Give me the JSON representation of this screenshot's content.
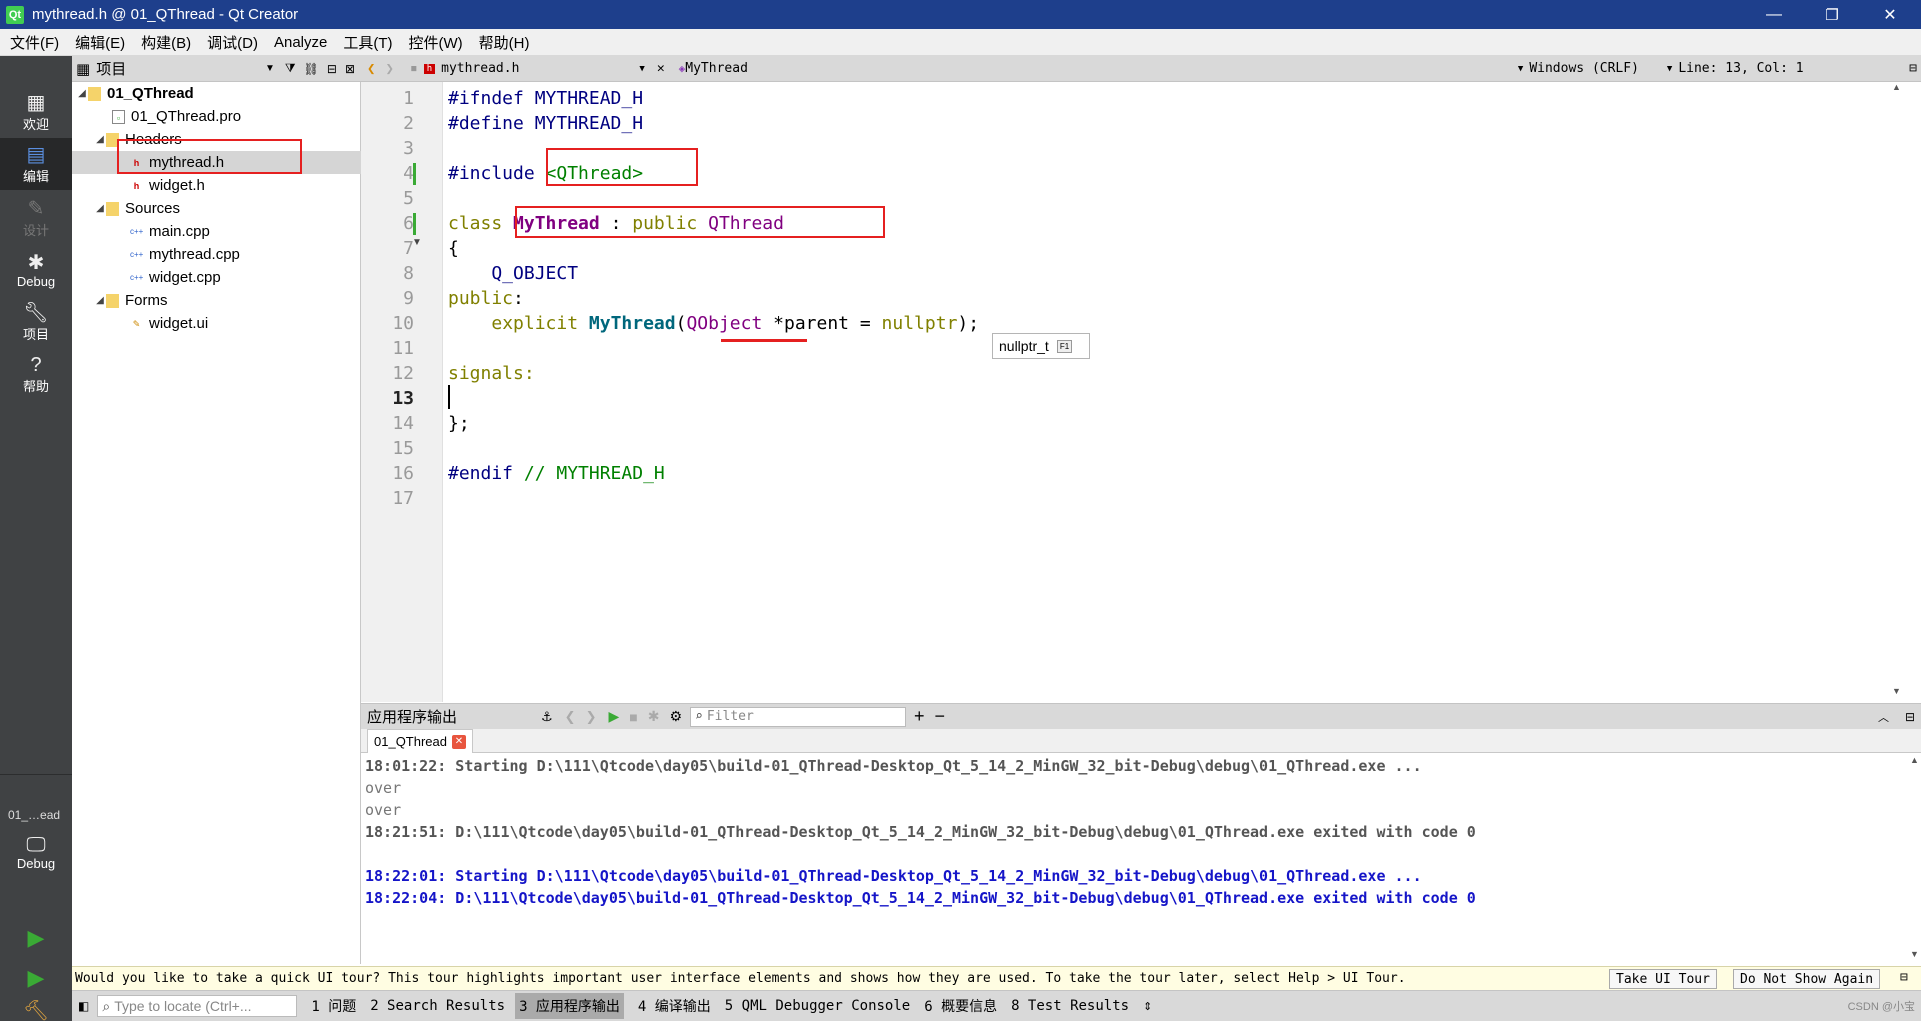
{
  "window": {
    "title": "mythread.h @ 01_QThread - Qt Creator",
    "logo": "Qt",
    "minimize": "—",
    "restore": "❐",
    "close": "✕"
  },
  "menu": [
    "文件(F)",
    "编辑(E)",
    "构建(B)",
    "调试(D)",
    "Analyze",
    "工具(T)",
    "控件(W)",
    "帮助(H)"
  ],
  "modes": {
    "welcome": "欢迎",
    "edit": "编辑",
    "design": "设计",
    "debug": "Debug",
    "projects": "项目",
    "help": "帮助",
    "kit_name": "01_…ead",
    "kit_mode": "Debug"
  },
  "project": {
    "panel_title": "项目",
    "root": "01_QThread",
    "pro_file": "01_QThread.pro",
    "headers": "Headers",
    "header_files": [
      "mythread.h",
      "widget.h"
    ],
    "sources": "Sources",
    "source_files": [
      "main.cpp",
      "mythread.cpp",
      "widget.cpp"
    ],
    "forms": "Forms",
    "form_files": [
      "widget.ui"
    ]
  },
  "editor": {
    "file_tab": "mythread.h",
    "symbol": "MyThread",
    "line_ending": "Windows (CRLF)",
    "position": "Line: 13, Col: 1",
    "line_numbers": [
      "1",
      "2",
      "3",
      "4",
      "5",
      "6",
      "7",
      "8",
      "9",
      "10",
      "11",
      "12",
      "13",
      "14",
      "15",
      "16",
      "17"
    ],
    "current_line": 13,
    "code": {
      "l1": "#ifndef MYTHREAD_H",
      "l2": "#define MYTHREAD_H",
      "l4_dir": "#include ",
      "l4_hdr": "<QThread>",
      "l6_kw": "class ",
      "l6_name": "MyThread",
      "l6_sep": " : ",
      "l6_pub": "public ",
      "l6_base": "QThread",
      "l7": "{",
      "l8": "    Q_OBJECT",
      "l9_kw": "public",
      "l9_colon": ":",
      "l10_indent": "    ",
      "l10_kw": "explicit ",
      "l10_fn": "MyThread",
      "l10_paren": "(",
      "l10_type": "QObject",
      "l10_sp": " ",
      "l10_star": "*",
      "l10_param": "parent = ",
      "l10_null": "nullptr",
      "l10_end": ");",
      "l12": "signals:",
      "l14": "};",
      "l16_dir": "#endif ",
      "l16_cmt": "// MYTHREAD_H"
    },
    "tooltip": "nullptr_t",
    "tooltip_key": "F1"
  },
  "output": {
    "title": "应用程序输出",
    "filter_placeholder": "Filter",
    "tab": "01_QThread",
    "lines": [
      "18:01:22: Starting D:\\111\\Qtcode\\day05\\build-01_QThread-Desktop_Qt_5_14_2_MinGW_32_bit-Debug\\debug\\01_QThread.exe ...",
      "over",
      "over",
      "18:21:51: D:\\111\\Qtcode\\day05\\build-01_QThread-Desktop_Qt_5_14_2_MinGW_32_bit-Debug\\debug\\01_QThread.exe exited with code 0",
      "18:22:01: Starting D:\\111\\Qtcode\\day05\\build-01_QThread-Desktop_Qt_5_14_2_MinGW_32_bit-Debug\\debug\\01_QThread.exe ...",
      "18:22:04: D:\\111\\Qtcode\\day05\\build-01_QThread-Desktop_Qt_5_14_2_MinGW_32_bit-Debug\\debug\\01_QThread.exe exited with code 0"
    ]
  },
  "tour": {
    "message": "Would you like to take a quick UI tour? This tour highlights important user interface elements and shows how they are used. To take the tour later, select Help > UI Tour.",
    "take_button": "Take UI Tour",
    "dismiss_button": "Do Not Show Again"
  },
  "status": {
    "locator_placeholder": "Type to locate (Ctrl+...",
    "tabs": [
      "1 问题",
      "2 Search Results",
      "3 应用程序输出",
      "4 编译输出",
      "5 QML Debugger Console",
      "6 概要信息",
      "8 Test Results"
    ],
    "watermark": "CSDN @小宝"
  },
  "colors": {
    "title_bar": "#1e3f8c",
    "mode_bar": "#404244",
    "highlight_box": "#e52020",
    "run_green": "#3aaa35"
  }
}
